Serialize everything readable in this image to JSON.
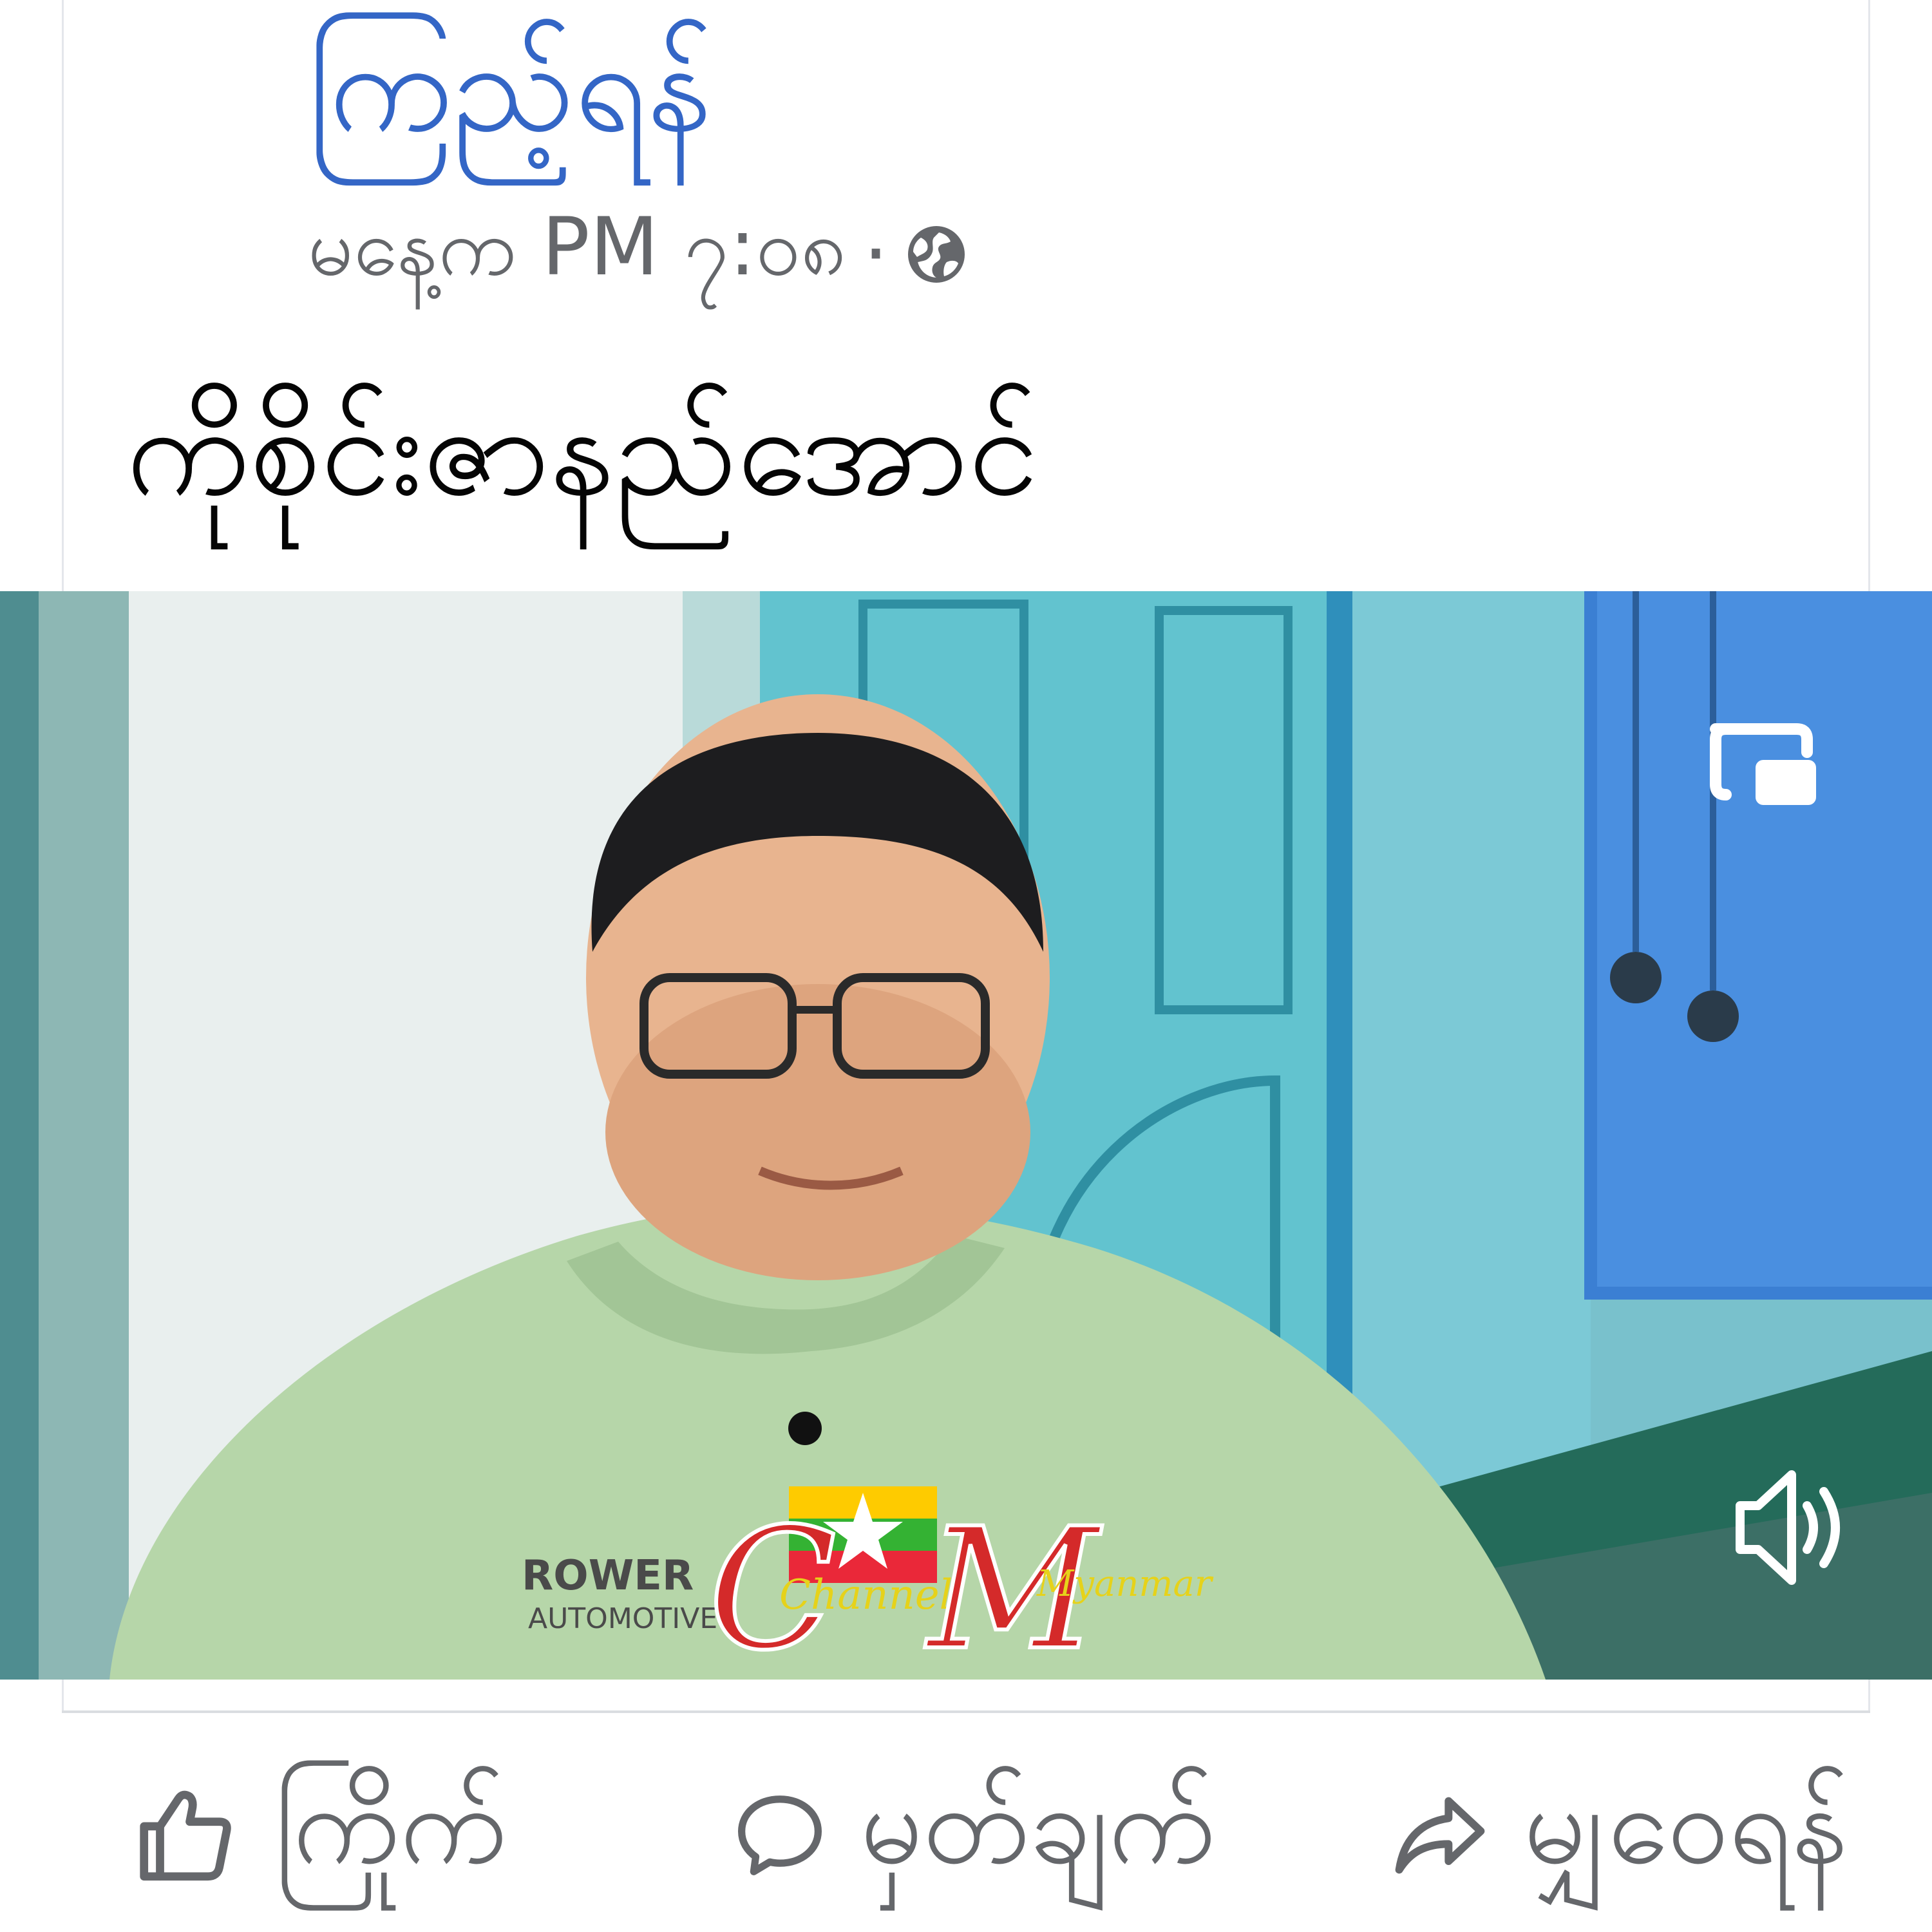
{
  "post": {
    "follow_label": "ကြည့်ရန်",
    "timestamp": "မနေ့က PM ၇:၀၈",
    "separator": "·",
    "privacy_icon": "globe-icon",
    "text": "ကိုစိုင်းဇာနည်အောင်"
  },
  "video": {
    "watermark_channel": "Channel",
    "watermark_myanmar": "Myanmar",
    "shirt_logo": "ROWER",
    "shirt_logo_sub": "AUTOMOTIVE",
    "pip_icon": "picture-in-picture-icon",
    "sound_icon": "speaker-icon"
  },
  "actions": {
    "like_label": "ကြိုက်",
    "comment_label": "မှတ်ချက်",
    "share_label": "မျှဝေရန်",
    "like_icon": "thumbs-up-icon",
    "comment_icon": "comment-icon",
    "share_icon": "share-arrow-icon"
  },
  "colors": {
    "link": "#3466c6",
    "meta_text": "#65676b",
    "flag_yellow": "#fecb00",
    "flag_green": "#34b233",
    "flag_red": "#ea2839"
  }
}
